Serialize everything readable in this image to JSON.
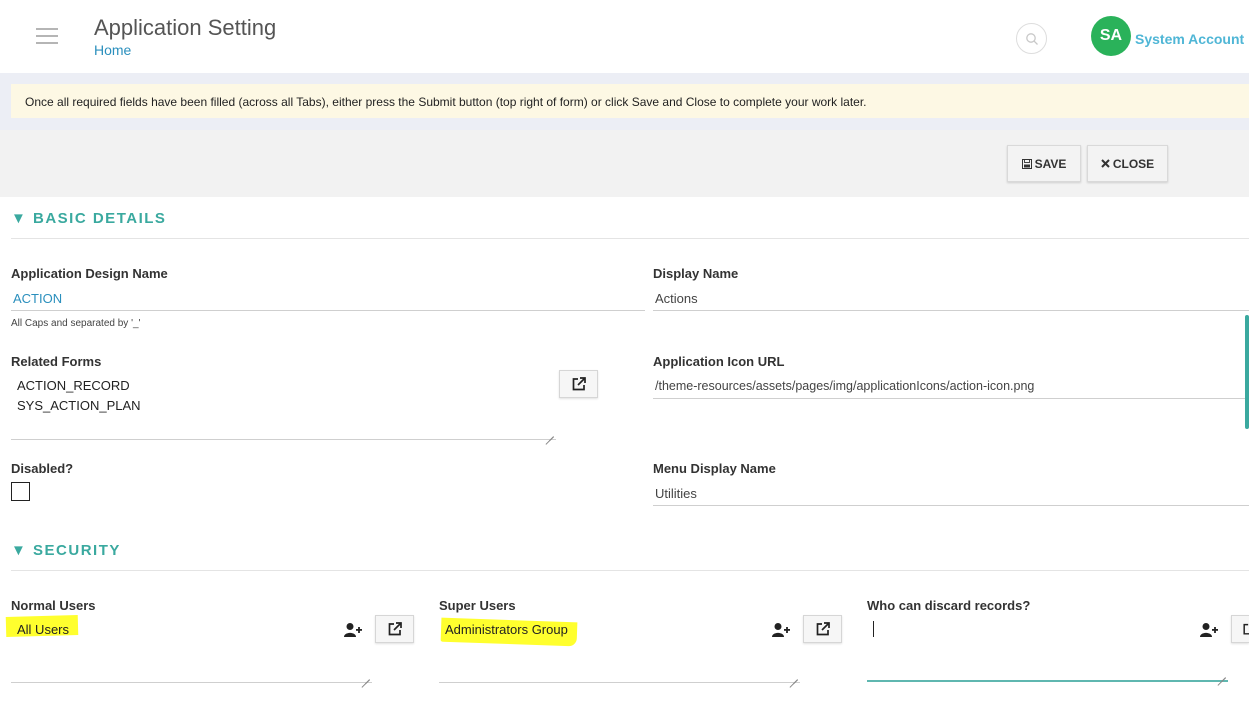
{
  "header": {
    "title": "Application Setting",
    "breadcrumb": "Home",
    "avatar_initials": "SA",
    "account_name": "System Account"
  },
  "notice": "Once all required fields have been filled (across all Tabs), either press the Submit button (top right of form) or click Save and Close to complete your work later.",
  "toolbar": {
    "save_label": "SAVE",
    "close_label": "CLOSE"
  },
  "basic": {
    "heading": "▼ BASIC DETAILS",
    "app_design_name_label": "Application Design Name",
    "app_design_name_value": "ACTION",
    "app_design_name_hint": "All Caps and separated by '_'",
    "display_name_label": "Display Name",
    "display_name_value": "Actions",
    "related_forms_label": "Related Forms",
    "related_forms": [
      "ACTION_RECORD",
      "SYS_ACTION_PLAN"
    ],
    "icon_url_label": "Application Icon URL",
    "icon_url_value": "/theme-resources/assets/pages/img/applicationIcons/action-icon.png",
    "disabled_label": "Disabled?",
    "disabled_checked": false,
    "menu_display_name_label": "Menu Display Name",
    "menu_display_name_value": "Utilities"
  },
  "security": {
    "heading": "▼ SECURITY",
    "normal_users_label": "Normal Users",
    "normal_users_value": "All Users",
    "super_users_label": "Super Users",
    "super_users_value": "Administrators Group",
    "discard_label": "Who can discard records?",
    "discard_value": ""
  },
  "colors": {
    "accent": "#3aa99f",
    "link": "#2a8fbd",
    "avatar": "#2ab25a",
    "highlight": "#ffff2e",
    "notice_bg": "#fdf8e4"
  },
  "icons": [
    "menu-icon",
    "search-icon",
    "floppy-icon",
    "close-x-icon",
    "external-link-icon",
    "user-plus-icon"
  ]
}
